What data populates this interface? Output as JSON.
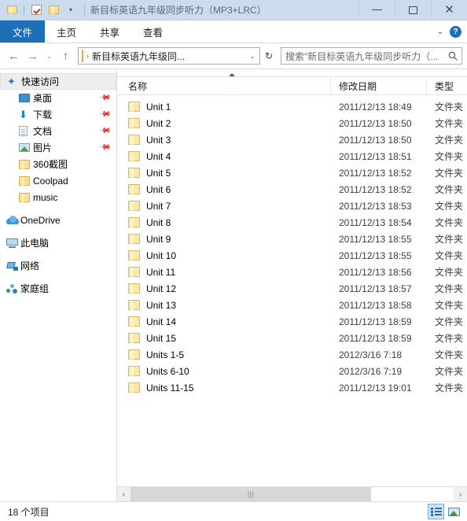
{
  "titlebar": {
    "title": "新目标英语九年级同步听力（MP3+LRC）",
    "quick_access": [
      {
        "name": "folder-icon",
        "label": ""
      },
      {
        "name": "properties-icon",
        "label": ""
      },
      {
        "name": "new-folder-icon",
        "label": ""
      },
      {
        "name": "customize-caret-icon",
        "label": "▾"
      }
    ],
    "controls": {
      "minimize": "—",
      "maximize": "□",
      "close": "✕"
    }
  },
  "ribbon": {
    "tabs": [
      {
        "label": "文件",
        "active": true
      },
      {
        "label": "主页",
        "active": false
      },
      {
        "label": "共享",
        "active": false
      },
      {
        "label": "查看",
        "active": false
      }
    ],
    "collapse": "⌄",
    "help": "?"
  },
  "addressbar": {
    "back": "←",
    "forward": "→",
    "recent": "⌄",
    "up": "↑",
    "separator": "›",
    "crumb": "新目标英语九年级同...",
    "dropdown": "⌄",
    "refresh": "↻"
  },
  "search": {
    "placeholder": "搜索\"新目标英语九年级同步听力（...",
    "icon": "search-icon"
  },
  "sidebar": {
    "items": [
      {
        "label": "快速访问",
        "icon": "star-pin-icon",
        "selected": true,
        "indent": false,
        "pinned": false
      },
      {
        "label": "桌面",
        "icon": "desktop-icon",
        "selected": false,
        "indent": true,
        "pinned": true
      },
      {
        "label": "下载",
        "icon": "download-icon",
        "selected": false,
        "indent": true,
        "pinned": true
      },
      {
        "label": "文档",
        "icon": "document-icon",
        "selected": false,
        "indent": true,
        "pinned": true
      },
      {
        "label": "图片",
        "icon": "pictures-icon",
        "selected": false,
        "indent": true,
        "pinned": true
      },
      {
        "label": "360截图",
        "icon": "folder-icon",
        "selected": false,
        "indent": true,
        "pinned": false
      },
      {
        "label": "Coolpad",
        "icon": "folder-icon",
        "selected": false,
        "indent": true,
        "pinned": false
      },
      {
        "label": "music",
        "icon": "folder-icon",
        "selected": false,
        "indent": true,
        "pinned": false
      },
      {
        "label": "OneDrive",
        "icon": "cloud-icon",
        "selected": false,
        "indent": false,
        "pinned": false
      },
      {
        "label": "此电脑",
        "icon": "computer-icon",
        "selected": false,
        "indent": false,
        "pinned": false
      },
      {
        "label": "网络",
        "icon": "network-icon",
        "selected": false,
        "indent": false,
        "pinned": false
      },
      {
        "label": "家庭组",
        "icon": "homegroup-icon",
        "selected": false,
        "indent": false,
        "pinned": false
      }
    ]
  },
  "filelist": {
    "columns": [
      "名称",
      "修改日期",
      "类型"
    ],
    "sort": {
      "column": "名称",
      "direction": "ascending"
    },
    "rows": [
      {
        "name": "Unit 1",
        "date": "2011/12/13 18:49",
        "type": "文件夹"
      },
      {
        "name": "Unit 2",
        "date": "2011/12/13 18:50",
        "type": "文件夹"
      },
      {
        "name": "Unit 3",
        "date": "2011/12/13 18:50",
        "type": "文件夹"
      },
      {
        "name": "Unit 4",
        "date": "2011/12/13 18:51",
        "type": "文件夹"
      },
      {
        "name": "Unit 5",
        "date": "2011/12/13 18:52",
        "type": "文件夹"
      },
      {
        "name": "Unit 6",
        "date": "2011/12/13 18:52",
        "type": "文件夹"
      },
      {
        "name": "Unit 7",
        "date": "2011/12/13 18:53",
        "type": "文件夹"
      },
      {
        "name": "Unit 8",
        "date": "2011/12/13 18:54",
        "type": "文件夹"
      },
      {
        "name": "Unit 9",
        "date": "2011/12/13 18:55",
        "type": "文件夹"
      },
      {
        "name": "Unit 10",
        "date": "2011/12/13 18:55",
        "type": "文件夹"
      },
      {
        "name": "Unit 11",
        "date": "2011/12/13 18:56",
        "type": "文件夹"
      },
      {
        "name": "Unit 12",
        "date": "2011/12/13 18:57",
        "type": "文件夹"
      },
      {
        "name": "Unit 13",
        "date": "2011/12/13 18:58",
        "type": "文件夹"
      },
      {
        "name": "Unit 14",
        "date": "2011/12/13 18:59",
        "type": "文件夹"
      },
      {
        "name": "Unit 15",
        "date": "2011/12/13 18:59",
        "type": "文件夹"
      },
      {
        "name": "Units 1-5",
        "date": "2012/3/16 7:18",
        "type": "文件夹"
      },
      {
        "name": "Units 6-10",
        "date": "2012/3/16 7:19",
        "type": "文件夹"
      },
      {
        "name": "Units 11-15",
        "date": "2011/12/13 19:01",
        "type": "文件夹"
      }
    ]
  },
  "scrollbar": {
    "left": "‹",
    "right": "›",
    "grip": "|||"
  },
  "statusbar": {
    "item_count": "18 个项目",
    "views": [
      {
        "name": "details-view-button",
        "active": true
      },
      {
        "name": "large-icons-view-button",
        "active": false
      }
    ]
  },
  "colors": {
    "titlebar": "#cbdcee",
    "accent": "#1d6fb8",
    "folder": "#fde8a6",
    "selection": "#e5f3fb"
  }
}
